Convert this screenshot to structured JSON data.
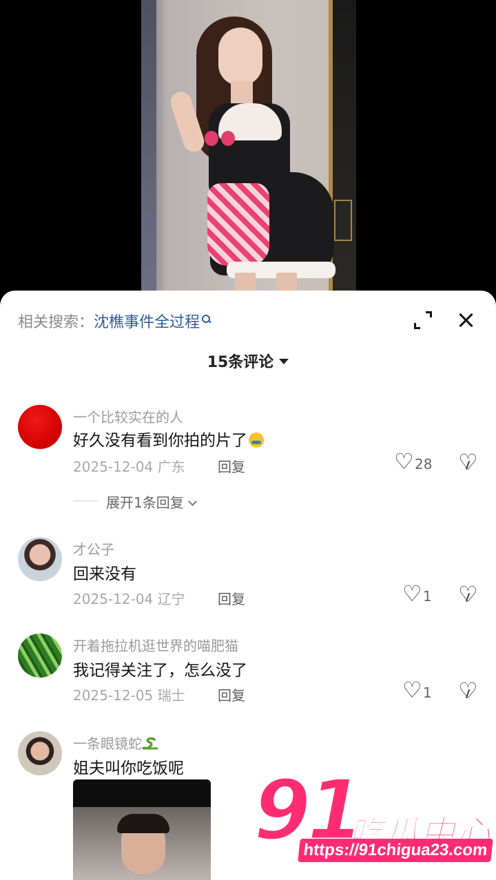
{
  "search": {
    "prefix": "相关搜索：",
    "term": "沈樵事件全过程"
  },
  "header": {
    "comment_count": "15条评论"
  },
  "comments": [
    {
      "user": "一个比较实在的人",
      "text": "好久没有看到你拍的片了",
      "date": "2025-12-04",
      "location": "广东",
      "reply_label": "回复",
      "likes": "28",
      "avatar_icon": "red-circle-avatar"
    },
    {
      "user": "才公子",
      "text": "回来没有",
      "date": "2025-12-04",
      "location": "辽宁",
      "reply_label": "回复",
      "likes": "1",
      "avatar_icon": "man-avatar"
    },
    {
      "user": "开着拖拉机逛世界的喵肥猫",
      "text": "我记得关注了，怎么没了",
      "date": "2025-12-05",
      "location": "瑞士",
      "reply_label": "回复",
      "likes": "1",
      "avatar_icon": "green-avatar"
    },
    {
      "user": "一条眼镜蛇",
      "text": "姐夫叫你吃饭呢",
      "avatar_icon": "man-avatar"
    }
  ],
  "expand_replies": "展开1条回复",
  "watermark": {
    "number": "91",
    "name": "吃瓜中心",
    "url": "https://91chigua23.com"
  },
  "colors": {
    "accent": "#2f5b99",
    "brand": "#ff2c74"
  }
}
